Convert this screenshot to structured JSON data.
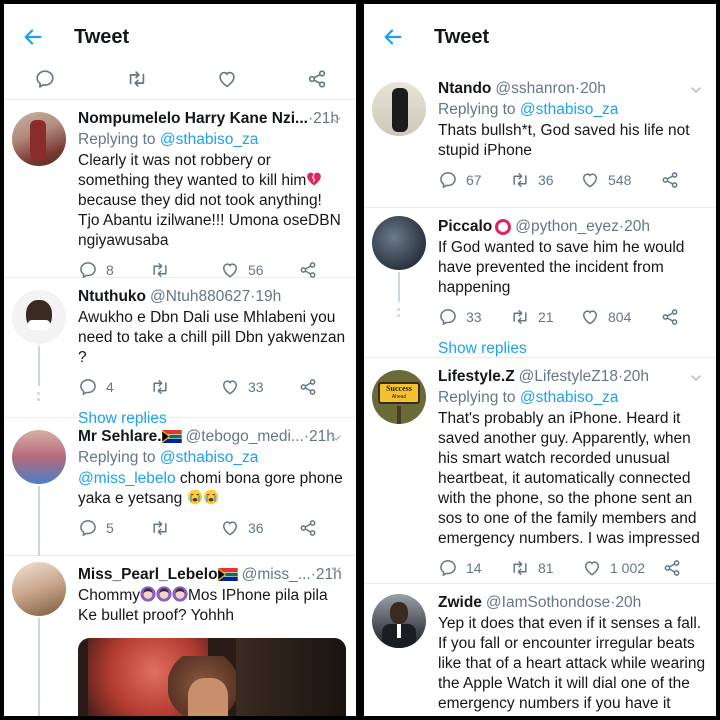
{
  "left": {
    "header": {
      "title": "Tweet"
    },
    "tweets": [
      {
        "name": "Nompumelelo Harry Kane Nzi...",
        "handle": "",
        "time": "21h",
        "replying_prefix": "Replying to ",
        "replying_to": "@sthabiso_za",
        "text_a": "Clearly it was not robbery or something they wanted to kill him",
        "text_b": " because they did not took anything! Tjo Abantu izilwane!!! Umona oseDBN ngiyawusaba",
        "replies": "8",
        "retweets": "",
        "likes": "56"
      },
      {
        "name": "Ntuthuko",
        "handle": "@Ntuh880627",
        "time": "19h",
        "text": "Awukho e Dbn Dali use Mhlabeni you need to take a chill pill Dbn yakwenzan ?",
        "replies": "4",
        "retweets": "",
        "likes": "33",
        "show_replies": "Show replies"
      },
      {
        "name": "Mr Sehlare.",
        "handle": "@tebogo_medi...",
        "time": "21h",
        "replying_prefix": "Replying to ",
        "replying_to": "@sthabiso_za",
        "mention": "@miss_lebelo",
        "text": " chomi bona gore phone yaka e yetsang ",
        "replies": "5",
        "retweets": "",
        "likes": "36"
      },
      {
        "name": "Miss_Pearl_Lebelo",
        "handle": "@miss_...",
        "time": "21h",
        "text_a": "Chommy",
        "text_b": "Mos IPhone pila pila Ke bullet proof? Yohhh"
      }
    ]
  },
  "right": {
    "header": {
      "title": "Tweet"
    },
    "tweets": [
      {
        "name": "Ntando",
        "handle": "@sshanron",
        "time": "20h",
        "replying_prefix": "Replying to ",
        "replying_to": "@sthabiso_za",
        "text": "Thats bullsh*t, God saved his life not stupid iPhone",
        "replies": "67",
        "retweets": "36",
        "likes": "548"
      },
      {
        "name": "Piccalo",
        "handle": "@python_eyez",
        "time": "20h",
        "text": "If God wanted to save him he would have prevented the incident from happening",
        "replies": "33",
        "retweets": "21",
        "likes": "804",
        "show_replies": "Show replies"
      },
      {
        "name": "Lifestyle.Z",
        "handle": "@LifestyleZ18",
        "time": "20h",
        "replying_prefix": "Replying to ",
        "replying_to": "@sthabiso_za",
        "text": "That's probably an iPhone. Heard it saved another guy. Apparently, when his smart watch recorded unusual heartbeat, it automatically connected with the phone, so the phone sent an sos to one of the family members and emergency numbers. I was impressed",
        "avatar_text": "Success",
        "avatar_subtext": "Ahead",
        "replies": "14",
        "retweets": "81",
        "likes": "1 002"
      },
      {
        "name": "Zwide",
        "handle": "@IamSothondose",
        "time": "20h",
        "text": "Yep it does that even if it senses a fall. If you fall or encounter irregular beats like that of a heart attack while wearing the Apple Watch it will dial one of the emergency numbers if you have it setup."
      }
    ]
  },
  "sep": " · ",
  "colors": {
    "accent": "#1da1f2",
    "muted": "#657786",
    "text": "#14171a",
    "divider": "#e6ecf0"
  },
  "icons": [
    "back-arrow-icon",
    "reply-icon",
    "retweet-icon",
    "like-icon",
    "share-icon",
    "chevron-down-icon",
    "broken-heart-emoji",
    "south-africa-flag-icon",
    "crying-face-emoji",
    "woman-emoji",
    "red-circle-emoji"
  ]
}
